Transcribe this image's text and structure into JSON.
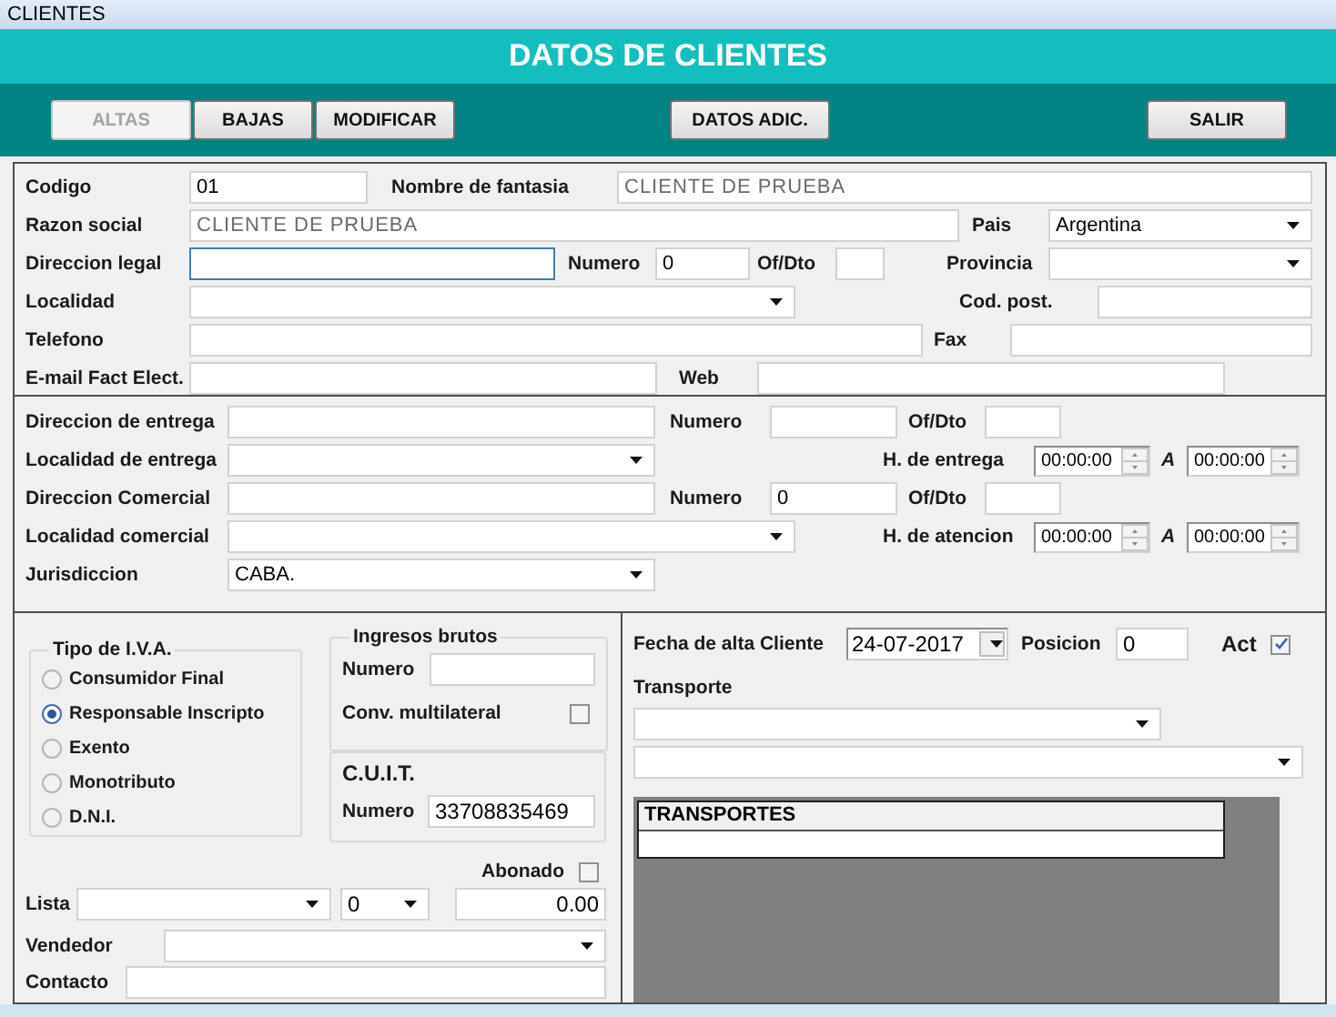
{
  "window": {
    "title": "CLIENTES"
  },
  "header": {
    "title": "DATOS DE CLIENTES"
  },
  "toolbar": [
    {
      "label": "ALTAS",
      "disabled": true
    },
    {
      "label": "BAJAS",
      "disabled": false
    },
    {
      "label": "MODIFICAR",
      "disabled": false
    },
    {
      "label": "DATOS ADIC.",
      "disabled": false
    },
    {
      "label": "SALIR",
      "disabled": false
    }
  ],
  "datos_generales": {
    "codigo": {
      "label": "Codigo",
      "value": "01"
    },
    "nombre_fantasia": {
      "label": "Nombre de fantasia",
      "value": "CLIENTE DE PRUEBA",
      "disabled": true
    },
    "razon_social": {
      "label": "Razon social",
      "value": "CLIENTE DE PRUEBA",
      "disabled": true
    },
    "pais": {
      "label": "Pais",
      "value": "Argentina"
    },
    "direccion_legal": {
      "label": "Direccion legal",
      "focused": true
    },
    "numero": {
      "label": "Numero",
      "value": "0"
    },
    "of_dto": {
      "label": "Of/Dto"
    },
    "provincia": {
      "label": "Provincia"
    },
    "localidad": {
      "label": "Localidad"
    },
    "cod_post": {
      "label": "Cod. post."
    },
    "telefono": {
      "label": "Telefono"
    },
    "fax": {
      "label": "Fax"
    },
    "email_fact_elect": {
      "label": "E-mail Fact Elect."
    },
    "web": {
      "label": "Web"
    }
  },
  "entrega": {
    "direccion_entrega": {
      "label": "Direccion de entrega"
    },
    "numero_entrega": {
      "label": "Numero"
    },
    "of_dto_entrega": {
      "label": "Of/Dto"
    },
    "localidad_entrega": {
      "label": "Localidad de entrega"
    },
    "h_entrega": {
      "label": "H. de entrega",
      "desde": "00:00:00",
      "separator": "A",
      "hasta": "00:00:00"
    },
    "direccion_comercial": {
      "label": "Direccion Comercial"
    },
    "numero_comercial": {
      "label": "Numero",
      "value": "0"
    },
    "of_dto_comercial": {
      "label": "Of/Dto"
    },
    "localidad_comercial": {
      "label": "Localidad comercial"
    },
    "h_atencion": {
      "label": "H. de atencion",
      "desde": "00:00:00",
      "separator": "A",
      "hasta": "00:00:00"
    },
    "jurisdiccion": {
      "label": "Jurisdiccion",
      "value": "CABA."
    }
  },
  "impuestos": {
    "tipo_iva": {
      "title": "Tipo de I.V.A.",
      "options": [
        {
          "label": "Consumidor Final",
          "selected": false
        },
        {
          "label": "Responsable Inscripto",
          "selected": true
        },
        {
          "label": "Exento",
          "selected": false
        },
        {
          "label": "Monotributo",
          "selected": false
        },
        {
          "label": "D.N.I.",
          "selected": false
        }
      ]
    },
    "ingresos_brutos": {
      "title": "Ingresos brutos",
      "numero": {
        "label": "Numero"
      },
      "conv_multilateral": {
        "label": "Conv. multilateral",
        "checked": false
      }
    },
    "cuit": {
      "title": "C.U.I.T.",
      "numero": {
        "label": "Numero",
        "value": "33708835469"
      }
    },
    "lista": {
      "label": "Lista",
      "nivel": "0"
    },
    "abonado": {
      "label": "Abonado",
      "checked": false,
      "value": "0.00"
    },
    "vendedor": {
      "label": "Vendedor"
    },
    "contacto": {
      "label": "Contacto"
    }
  },
  "alta": {
    "fecha_alta": {
      "label": "Fecha de alta Cliente",
      "value": "24-07-2017"
    },
    "posicion": {
      "label": "Posicion",
      "value": "0"
    },
    "act": {
      "label": "Act",
      "checked": true
    },
    "transporte": {
      "label": "Transporte"
    },
    "transportes_grid": {
      "columns": [
        "TRANSPORTES"
      ]
    }
  }
}
